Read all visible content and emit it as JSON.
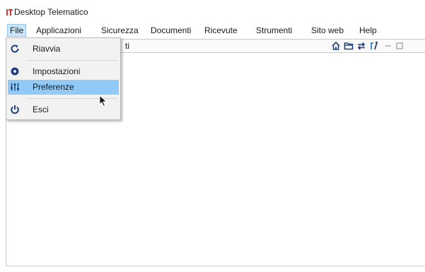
{
  "window": {
    "title": "Desktop Telematico",
    "icon": "app-logo-icon"
  },
  "menubar": {
    "items": [
      {
        "label": "File",
        "active": true
      },
      {
        "label": "Applicazioni"
      },
      {
        "label": "Sicurezza"
      },
      {
        "label": "Documenti"
      },
      {
        "label": "Ricevute"
      },
      {
        "label": "Strumenti"
      },
      {
        "label": "Sito web"
      },
      {
        "label": "Help"
      }
    ]
  },
  "toolbar": {
    "partial_text": "ti",
    "icons": [
      "home-icon",
      "folder-icon",
      "sync-arrows-icon",
      "tool-icon",
      "minimize-icon",
      "restore-icon"
    ]
  },
  "file_menu": {
    "items": [
      {
        "label": "Riavvia",
        "icon": "restart-icon"
      },
      {
        "label": "Impostazioni",
        "icon": "settings-icon"
      },
      {
        "label": "Preferenze",
        "icon": "sliders-icon",
        "selected": true
      },
      {
        "label": "Esci",
        "icon": "power-icon"
      }
    ]
  },
  "colors": {
    "accent": "#2f7bd1",
    "selected_bg": "#91c9f7",
    "menu_bg": "#f2f2f2",
    "icon_dark": "#1f3f7a"
  }
}
